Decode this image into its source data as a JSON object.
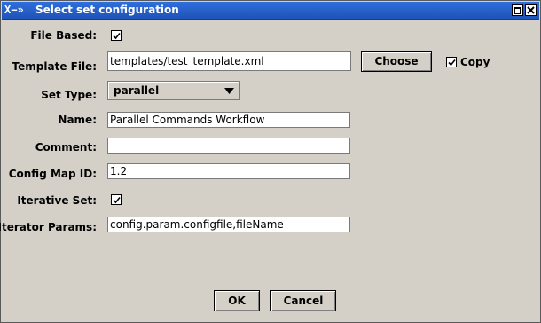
{
  "window": {
    "title": "Select set configuration",
    "title_icon_glyph": "X−»"
  },
  "form": {
    "file_based": {
      "label": "File Based:",
      "checked": true
    },
    "template_file": {
      "label": "Template File:",
      "value": "templates/test_template.xml"
    },
    "choose_button": "Choose",
    "copy": {
      "label": "Copy",
      "checked": true
    },
    "set_type": {
      "label": "Set Type:",
      "selected": "parallel"
    },
    "name": {
      "label": "Name:",
      "value": "Parallel Commands Workflow"
    },
    "comment": {
      "label": "Comment:",
      "value": ""
    },
    "config_map_id": {
      "label": "Config Map ID:",
      "value": "1.2"
    },
    "iterative_set": {
      "label": "Iterative Set:",
      "checked": true
    },
    "iterator_params": {
      "label": "Iterator Params:",
      "value": "config.param.configfile,fileName"
    }
  },
  "buttons": {
    "ok": "OK",
    "cancel": "Cancel"
  },
  "colors": {
    "titlebar": "#1f53b8",
    "background": "#d4d0c8"
  }
}
